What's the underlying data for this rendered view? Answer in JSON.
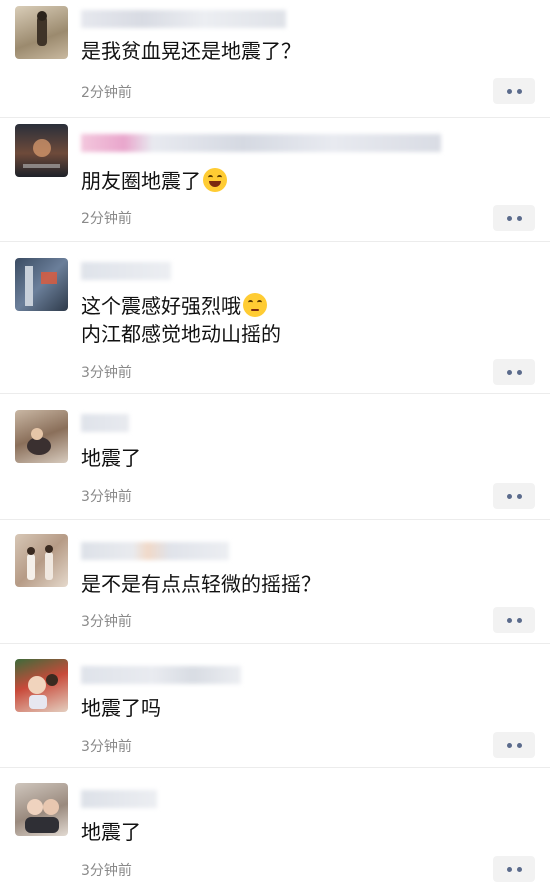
{
  "comments": [
    {
      "text": "是我贫血晃还是地震了？",
      "time": "2分钟前",
      "emoji": ""
    },
    {
      "text": "朋友圈地震了",
      "time": "2分钟前",
      "emoji": "laughing-tears-emoji"
    },
    {
      "text": "这个震感好强烈哦",
      "text2": "内江都感觉地动山摇的",
      "time": "3分钟前",
      "emoji": "eye-roll-emoji"
    },
    {
      "text": "地震了",
      "time": "3分钟前",
      "emoji": ""
    },
    {
      "text": "是不是有点点轻微的摇摇？",
      "time": "3分钟前",
      "emoji": ""
    },
    {
      "text": "地震了吗",
      "time": "3分钟前",
      "emoji": ""
    },
    {
      "text": "地震了",
      "time": "3分钟前",
      "emoji": ""
    }
  ],
  "icons": {
    "more": "more-dots-icon"
  },
  "colors": {
    "text": "#111111",
    "time": "#8a8a8a",
    "more_dots": "#5b6b8c",
    "more_bg": "#f2f2f2"
  }
}
